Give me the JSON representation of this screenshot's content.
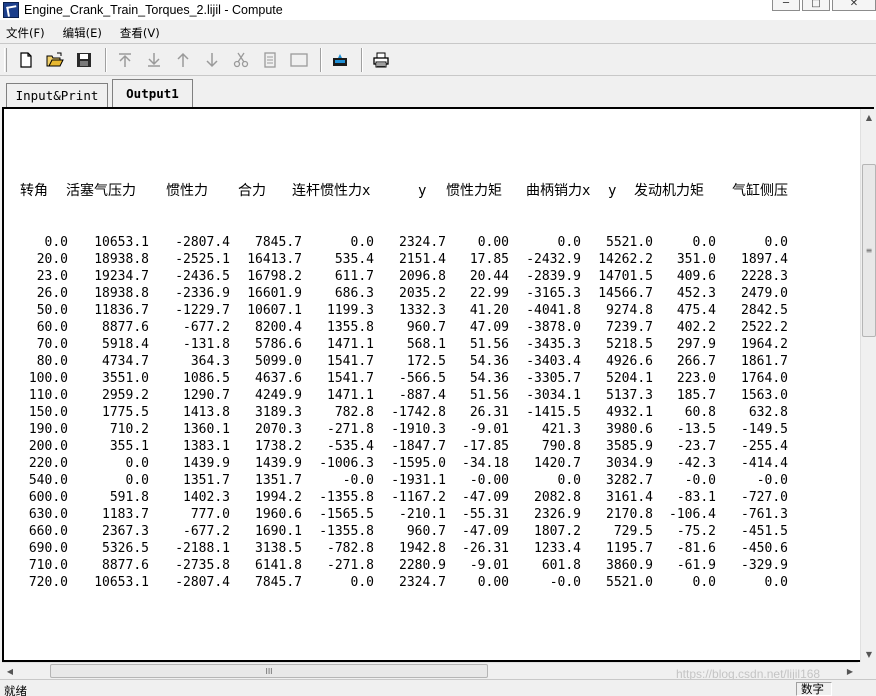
{
  "window": {
    "title": "Engine_Crank_Train_Torques_2.lijil - Compute",
    "controls": [
      "─",
      "□",
      "✕"
    ]
  },
  "menu": {
    "items": [
      "文件(F)",
      "编辑(E)",
      "查看(V)"
    ]
  },
  "toolbar": {
    "icons": [
      "new-document-icon",
      "open-folder-icon",
      "save-icon",
      "move-top-icon",
      "move-bottom-icon",
      "move-up-icon",
      "move-down-icon",
      "cut-icon",
      "copy-icon",
      "blank-icon",
      "camera-icon",
      "print-icon"
    ]
  },
  "tabs": [
    {
      "label": "Input&Print",
      "active": false
    },
    {
      "label": "Output1",
      "active": true
    }
  ],
  "table": {
    "headers": [
      "转角",
      "活塞气压力",
      "惯性力",
      "合力",
      "连杆惯性力x",
      "y",
      "惯性力矩",
      "曲柄销力x",
      "y",
      "发动机力矩",
      "气缸侧压"
    ],
    "rows": [
      [
        "0.0",
        "10653.1",
        "-2807.4",
        "7845.7",
        "0.0",
        "2324.7",
        "0.00",
        "0.0",
        "5521.0",
        "0.0",
        "0.0"
      ],
      [
        "20.0",
        "18938.8",
        "-2525.1",
        "16413.7",
        "535.4",
        "2151.4",
        "17.85",
        "-2432.9",
        "14262.2",
        "351.0",
        "1897.4"
      ],
      [
        "23.0",
        "19234.7",
        "-2436.5",
        "16798.2",
        "611.7",
        "2096.8",
        "20.44",
        "-2839.9",
        "14701.5",
        "409.6",
        "2228.3"
      ],
      [
        "26.0",
        "18938.8",
        "-2336.9",
        "16601.9",
        "686.3",
        "2035.2",
        "22.99",
        "-3165.3",
        "14566.7",
        "452.3",
        "2479.0"
      ],
      [
        "50.0",
        "11836.7",
        "-1229.7",
        "10607.1",
        "1199.3",
        "1332.3",
        "41.20",
        "-4041.8",
        "9274.8",
        "475.4",
        "2842.5"
      ],
      [
        "60.0",
        "8877.6",
        "-677.2",
        "8200.4",
        "1355.8",
        "960.7",
        "47.09",
        "-3878.0",
        "7239.7",
        "402.2",
        "2522.2"
      ],
      [
        "70.0",
        "5918.4",
        "-131.8",
        "5786.6",
        "1471.1",
        "568.1",
        "51.56",
        "-3435.3",
        "5218.5",
        "297.9",
        "1964.2"
      ],
      [
        "80.0",
        "4734.7",
        "364.3",
        "5099.0",
        "1541.7",
        "172.5",
        "54.36",
        "-3403.4",
        "4926.6",
        "266.7",
        "1861.7"
      ],
      [
        "100.0",
        "3551.0",
        "1086.5",
        "4637.6",
        "1541.7",
        "-566.5",
        "54.36",
        "-3305.7",
        "5204.1",
        "223.0",
        "1764.0"
      ],
      [
        "110.0",
        "2959.2",
        "1290.7",
        "4249.9",
        "1471.1",
        "-887.4",
        "51.56",
        "-3034.1",
        "5137.3",
        "185.7",
        "1563.0"
      ],
      [
        "150.0",
        "1775.5",
        "1413.8",
        "3189.3",
        "782.8",
        "-1742.8",
        "26.31",
        "-1415.5",
        "4932.1",
        "60.8",
        "632.8"
      ],
      [
        "190.0",
        "710.2",
        "1360.1",
        "2070.3",
        "-271.8",
        "-1910.3",
        "-9.01",
        "421.3",
        "3980.6",
        "-13.5",
        "-149.5"
      ],
      [
        "200.0",
        "355.1",
        "1383.1",
        "1738.2",
        "-535.4",
        "-1847.7",
        "-17.85",
        "790.8",
        "3585.9",
        "-23.7",
        "-255.4"
      ],
      [
        "220.0",
        "0.0",
        "1439.9",
        "1439.9",
        "-1006.3",
        "-1595.0",
        "-34.18",
        "1420.7",
        "3034.9",
        "-42.3",
        "-414.4"
      ],
      [
        "540.0",
        "0.0",
        "1351.7",
        "1351.7",
        "-0.0",
        "-1931.1",
        "-0.00",
        "0.0",
        "3282.7",
        "-0.0",
        "-0.0"
      ],
      [
        "600.0",
        "591.8",
        "1402.3",
        "1994.2",
        "-1355.8",
        "-1167.2",
        "-47.09",
        "2082.8",
        "3161.4",
        "-83.1",
        "-727.0"
      ],
      [
        "630.0",
        "1183.7",
        "777.0",
        "1960.6",
        "-1565.5",
        "-210.1",
        "-55.31",
        "2326.9",
        "2170.8",
        "-106.4",
        "-761.3"
      ],
      [
        "660.0",
        "2367.3",
        "-677.2",
        "1690.1",
        "-1355.8",
        "960.7",
        "-47.09",
        "1807.2",
        "729.5",
        "-75.2",
        "-451.5"
      ],
      [
        "690.0",
        "5326.5",
        "-2188.1",
        "3138.5",
        "-782.8",
        "1942.8",
        "-26.31",
        "1233.4",
        "1195.7",
        "-81.6",
        "-450.6"
      ],
      [
        "710.0",
        "8877.6",
        "-2735.8",
        "6141.8",
        "-271.8",
        "2280.9",
        "-9.01",
        "601.8",
        "3860.9",
        "-61.9",
        "-329.9"
      ],
      [
        "720.0",
        "10653.1",
        "-2807.4",
        "7845.7",
        "0.0",
        "2324.7",
        "0.00",
        "-0.0",
        "5521.0",
        "0.0",
        "0.0"
      ]
    ]
  },
  "scrollbars": {
    "h_thumb_label": "III",
    "v_thumb_label": "≡"
  },
  "status": {
    "text": "就绪",
    "panel": "数字"
  },
  "watermark": "https://blog.csdn.net/lijil168"
}
